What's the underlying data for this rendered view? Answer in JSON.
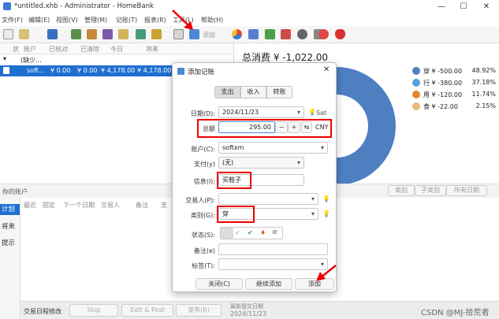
{
  "window": {
    "title": "*untitled.xhb - Administrator - HomeBank",
    "min": "—",
    "max": "☐",
    "close": "✕"
  },
  "menu": [
    "文件(F)",
    "编辑(E)",
    "视图(V)",
    "管理(M)",
    "记账(T)",
    "报表(R)",
    "工具(L)",
    "帮助(H)"
  ],
  "toolbar": {
    "add_label": "添加"
  },
  "accounts": {
    "headers": [
      "状",
      "账户",
      "已核对",
      "已清除",
      "今日",
      "将来"
    ],
    "group": "(缺少...",
    "row": {
      "name": "soft...",
      "reconciled": "¥ 0.00",
      "cleared": "¥ 0.00",
      "today": "¥ 4,178.00",
      "future": "¥ 4,178.00"
    }
  },
  "summary": {
    "title": "总消费 ¥ -1,022.00",
    "legend": [
      {
        "label": "穿 ¥ -500.00",
        "pct": "48.92%",
        "color": "#4e7fc0"
      },
      {
        "label": "行 ¥ -380.00",
        "pct": "37.18%",
        "color": "#5aa0d8"
      },
      {
        "label": "用 ¥ -120.00",
        "pct": "11.74%",
        "color": "#e0882a"
      },
      {
        "label": "食 ¥ -22.00",
        "pct": "2.15%",
        "color": "#e8b87a"
      }
    ]
  },
  "bottom": {
    "title": "你的账户",
    "tabs": [
      "类别",
      "子类别",
      "所有日期"
    ],
    "side_tabs": [
      "计划",
      "将来",
      "提示"
    ],
    "sched_headers": [
      "最近",
      "固定",
      "下一个日期",
      "交易人",
      "备注",
      "支"
    ],
    "bar_title": "交易日程修改",
    "bar_buttons": [
      "Skip",
      "Edit & Post",
      "发布(R)"
    ],
    "date_label": "最新提交日期",
    "date": "2024/11/23"
  },
  "dialog": {
    "title": "添加记账",
    "tabs": [
      "支出",
      "收入",
      "转账"
    ],
    "date_label": "日期(D):",
    "date": "2024/11/23",
    "weekday": "Sat",
    "amount_label": "总额",
    "amount": "295.00",
    "currency": "CNY",
    "account_label": "账户(C):",
    "account": "softxm",
    "payment_label": "支付(y)",
    "payment": "(无)",
    "info_label": "信息(I):",
    "info": "买鞋子",
    "payee_label": "交易人(P):",
    "payee": "",
    "category_label": "类别(G):",
    "category": "穿",
    "status_label": "状态(S):",
    "memo_label": "备注(e)",
    "memo": "",
    "tags_label": "标签(T):",
    "tags": "",
    "btn_close": "关闭(C)",
    "btn_continue": "继续添加",
    "btn_add": "添加"
  },
  "watermark": "CSDN @MJ-拾荒者"
}
